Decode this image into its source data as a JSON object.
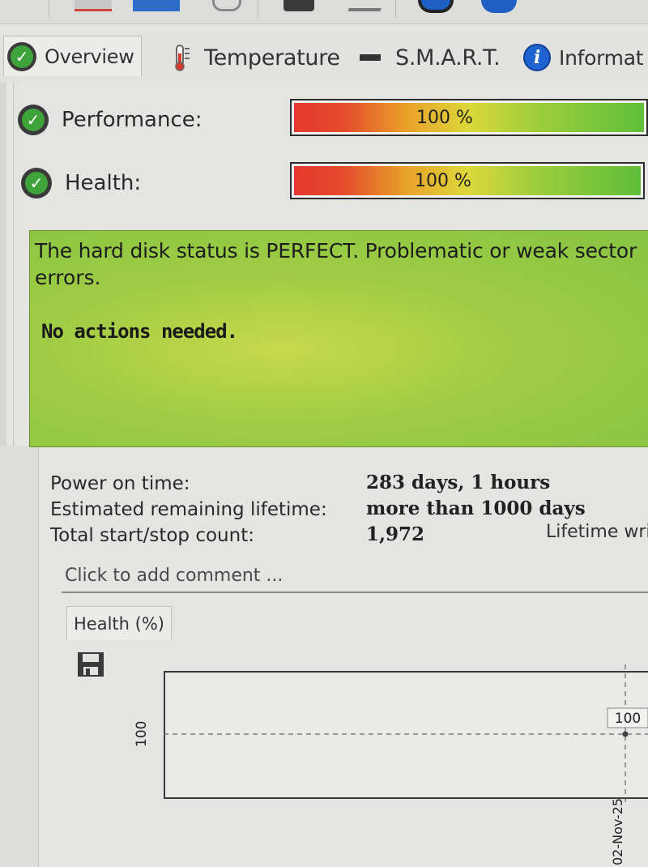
{
  "tabs": [
    {
      "label": "Overview",
      "icon": "check-circle-icon",
      "active": true
    },
    {
      "label": "Temperature",
      "icon": "thermometer-icon",
      "active": false
    },
    {
      "label": "S.M.A.R.T.",
      "icon": "disk-icon",
      "active": false
    },
    {
      "label": "Informat",
      "icon": "info-icon",
      "active": false
    }
  ],
  "status": {
    "performance": {
      "label": "Performance:",
      "value_text": "100 %",
      "value": 100
    },
    "health": {
      "label": "Health:",
      "value_text": "100 %",
      "value": 100
    }
  },
  "message": {
    "line1": "The hard disk status is PERFECT. Problematic or weak sector",
    "line2": "errors.",
    "action": "No actions needed."
  },
  "details": {
    "power_on_label": "Power on time:",
    "power_on_value": "283 days, 1 hours",
    "lifetime_label": "Estimated remaining lifetime:",
    "lifetime_value": "more than 1000 days",
    "startstop_label": "Total start/stop count:",
    "startstop_value": "1,972",
    "lifetime_writes_label": "Lifetime wri"
  },
  "comment_placeholder": "Click to add comment ...",
  "chart_tab": {
    "label": "Health (%)"
  },
  "chart_data": {
    "type": "line",
    "title": "",
    "ylabel": "",
    "xlabel": "",
    "y_ticks": [
      "100"
    ],
    "x": [
      "02-Nov-25"
    ],
    "series": [
      {
        "values": [
          100
        ]
      }
    ],
    "point_label": "100",
    "grid": true
  },
  "colors": {
    "ok_green": "#3ea33a",
    "bar_red": "#e5382f",
    "bar_green": "#5fbf3a",
    "panel_green": "#9fcc45",
    "info_blue": "#1e63d0"
  }
}
